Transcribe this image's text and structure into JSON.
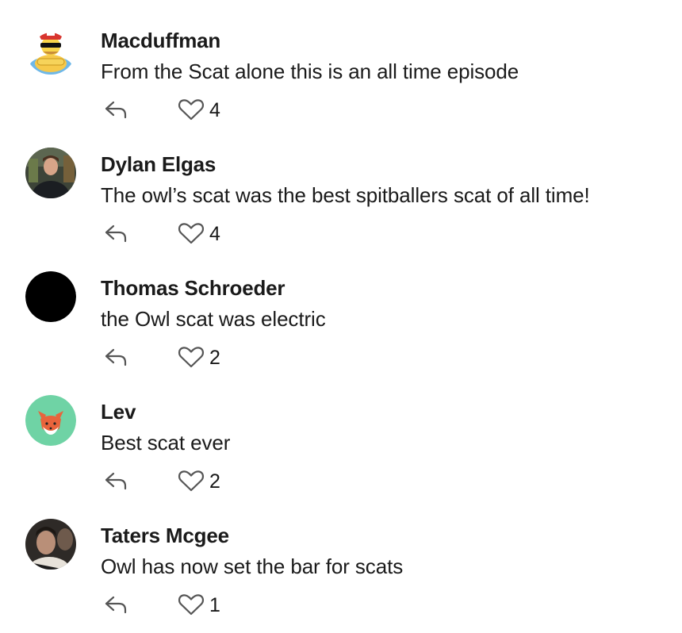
{
  "comments": [
    {
      "author": "Macduffman",
      "text": "From the Scat alone this is an all time episode",
      "likes": "4",
      "avatar": "cartoon-character-avatar"
    },
    {
      "author": "Dylan Elgas",
      "text": "The owl’s scat was the best spitballers scat of all time!",
      "likes": "4",
      "avatar": "photo-avatar"
    },
    {
      "author": "Thomas Schroeder",
      "text": "the Owl scat was electric",
      "likes": "2",
      "avatar": "black-circle-avatar"
    },
    {
      "author": "Lev",
      "text": "Best scat ever",
      "likes": "2",
      "avatar": "fox-avatar"
    },
    {
      "author": "Taters Mcgee",
      "text": "Owl has now set the bar for scats",
      "likes": "1",
      "avatar": "photo-avatar"
    }
  ],
  "icons": {
    "reply": "reply-arrow-icon",
    "like": "heart-outline-icon"
  },
  "colors": {
    "text": "#1a1a1a",
    "icon": "#555555",
    "fox_bg": "#6fd3a5",
    "fox": "#e8643c"
  }
}
